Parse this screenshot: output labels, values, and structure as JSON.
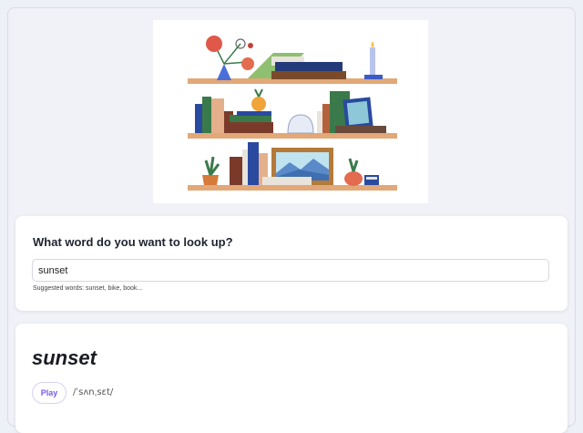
{
  "search": {
    "question": "What word do you want to look up?",
    "value": "sunset",
    "suggestions": "Suggested words: sunset, bike, book..."
  },
  "result": {
    "word": "sunset",
    "play_label": "Play",
    "phonetic": "/ˈsʌnˌsɛt/"
  },
  "colors": {
    "background": "#eef0f7",
    "accent": "#7a5af0"
  }
}
